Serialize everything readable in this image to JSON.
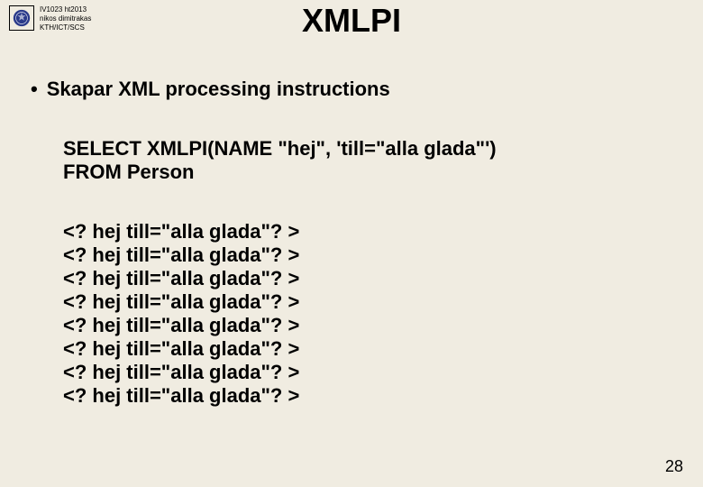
{
  "header": {
    "course_line1": "IV1023 ht2013",
    "course_line2": "nikos dimitrakas",
    "course_line3": "KTH/ICT/SCS"
  },
  "title": "XMLPI",
  "bullet": {
    "dot": "•",
    "text": "Skapar XML processing instructions"
  },
  "sql": {
    "line1": "SELECT XMLPI(NAME \"hej\", 'till=\"alla glada\"')",
    "line2": "FROM Person"
  },
  "output": [
    "<? hej till=\"alla glada\"? >",
    "<? hej till=\"alla glada\"? >",
    "<? hej till=\"alla glada\"? >",
    "<? hej till=\"alla glada\"? >",
    "<? hej till=\"alla glada\"? >",
    "<? hej till=\"alla glada\"? >",
    "<? hej till=\"alla glada\"? >",
    "<? hej till=\"alla glada\"? >"
  ],
  "page_number": "28"
}
